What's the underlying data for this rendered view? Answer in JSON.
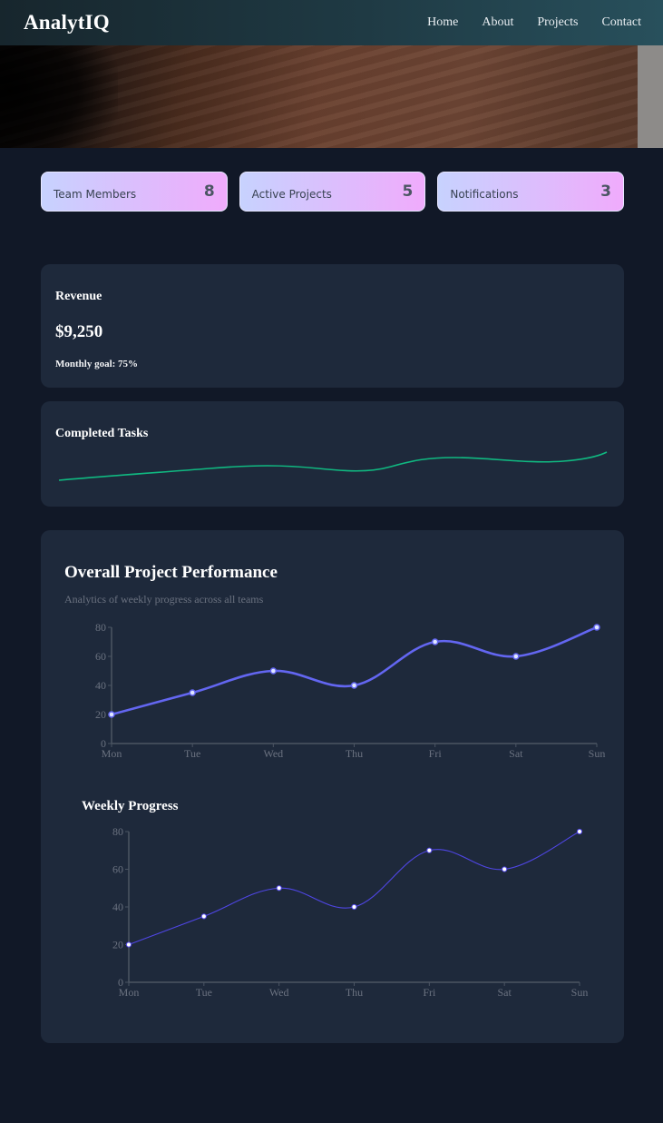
{
  "header": {
    "brand": "AnalytIQ",
    "nav": [
      "Home",
      "About",
      "Projects",
      "Contact"
    ]
  },
  "stats": [
    {
      "label": "Team Members",
      "value": "8"
    },
    {
      "label": "Active Projects",
      "value": "5"
    },
    {
      "label": "Notifications",
      "value": "3"
    }
  ],
  "revenue": {
    "title": "Revenue",
    "amount": "$9,250",
    "goal": "Monthly goal: 75%"
  },
  "tasks": {
    "title": "Completed Tasks",
    "spark_color": "#10b981"
  },
  "performance": {
    "title": "Overall Project Performance",
    "subtitle": "Analytics of weekly progress across all teams",
    "weekly_title": "Weekly Progress"
  },
  "colors": {
    "accent": "#6366f1",
    "card_gradient_start": "#c7d2fe",
    "card_gradient_end": "#f0abfc",
    "panel": "#1e293b",
    "background": "#111827"
  },
  "chart_data": [
    {
      "type": "line",
      "categories": [
        "Mon",
        "Tue",
        "Wed",
        "Thu",
        "Fri",
        "Sat",
        "Sun"
      ],
      "values": [
        20,
        35,
        50,
        40,
        70,
        60,
        80
      ],
      "title": "",
      "ylim": [
        0,
        80
      ],
      "yticks": [
        0,
        20,
        40,
        60,
        80
      ],
      "grid": false,
      "color": "#6366f1"
    },
    {
      "type": "line",
      "categories": [
        "Mon",
        "Tue",
        "Wed",
        "Thu",
        "Fri",
        "Sat",
        "Sun"
      ],
      "values": [
        20,
        35,
        50,
        40,
        70,
        60,
        80
      ],
      "title": "Weekly Progress",
      "ylim": [
        0,
        80
      ],
      "yticks": [
        0,
        20,
        40,
        60,
        80
      ],
      "grid": false,
      "color": "#4f46e5"
    }
  ]
}
